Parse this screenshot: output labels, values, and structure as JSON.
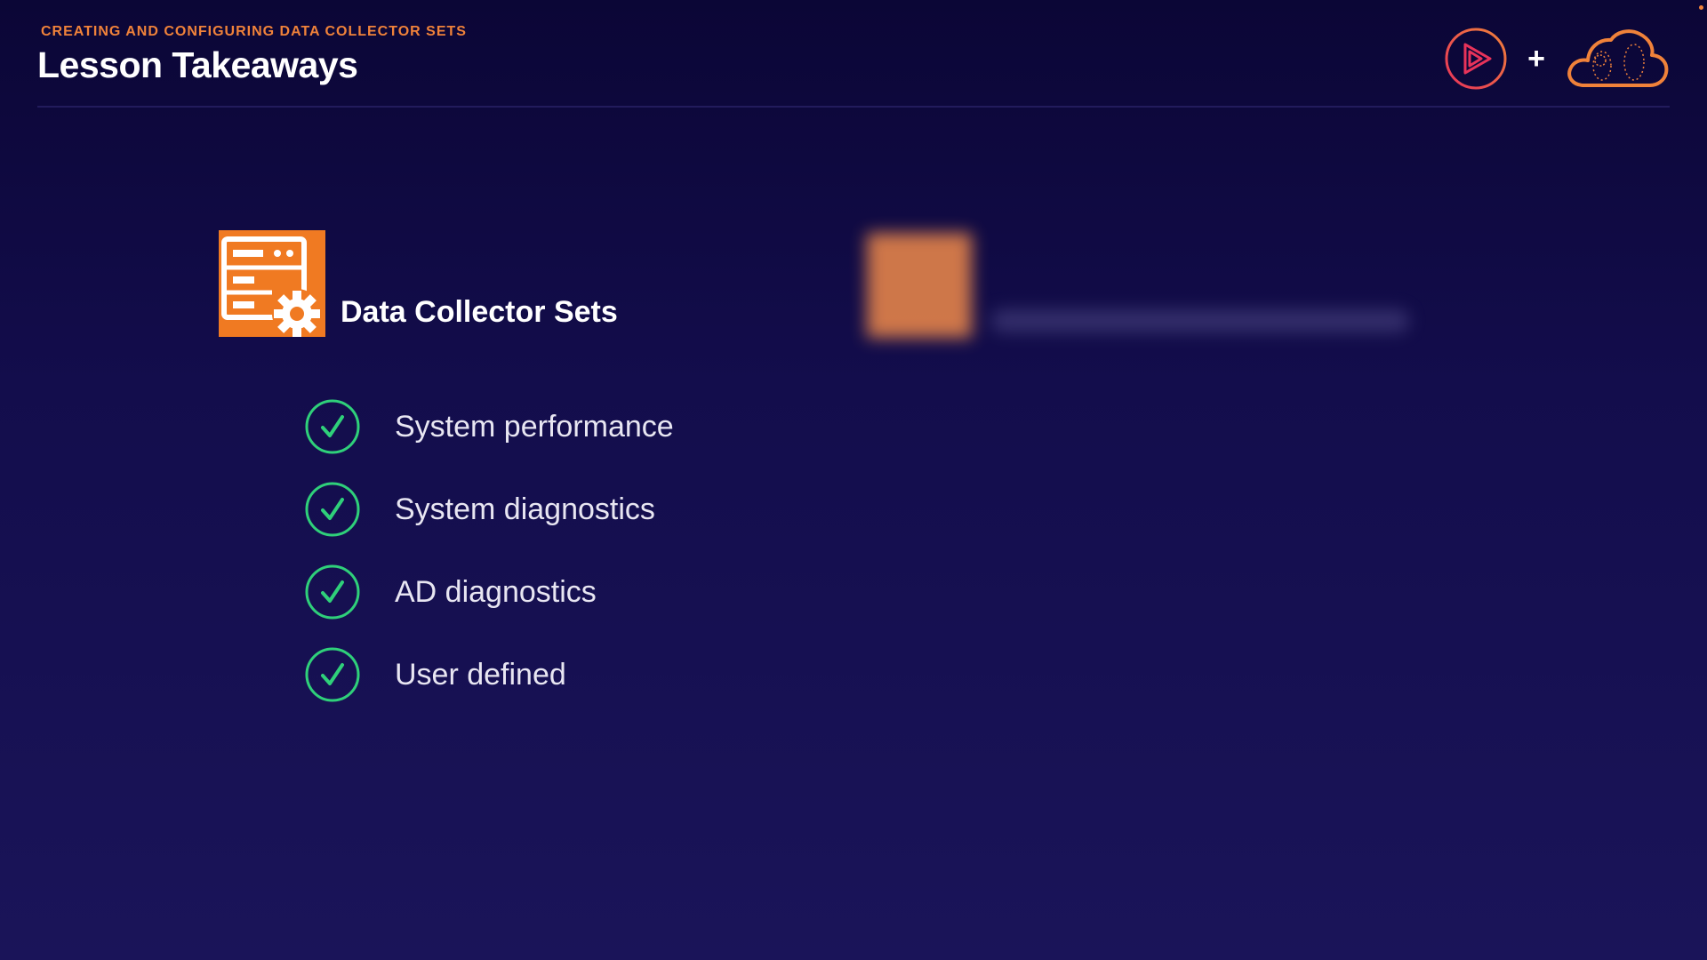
{
  "header": {
    "subtitle": "CREATING AND CONFIGURING DATA COLLECTOR SETS",
    "title": "Lesson Takeaways",
    "plus": "+"
  },
  "brand": {
    "logos": [
      "play-circle-logo",
      "cloud-logo"
    ],
    "accent_pink": "#e8335a",
    "accent_orange": "#f0823a"
  },
  "section": {
    "title": "Data Collector Sets",
    "icon": "server-gear-icon",
    "icon_color": "#f07a22"
  },
  "takeaways": [
    {
      "label": "System performance",
      "icon": "check-circle-icon"
    },
    {
      "label": "System diagnostics",
      "icon": "check-circle-icon"
    },
    {
      "label": "AD diagnostics",
      "icon": "check-circle-icon"
    },
    {
      "label": "User defined",
      "icon": "check-circle-icon"
    }
  ],
  "colors": {
    "background_top": "#0b0636",
    "background_bottom": "#1a1459",
    "check_green": "#2fd07a",
    "text": "#e8e6f2"
  }
}
